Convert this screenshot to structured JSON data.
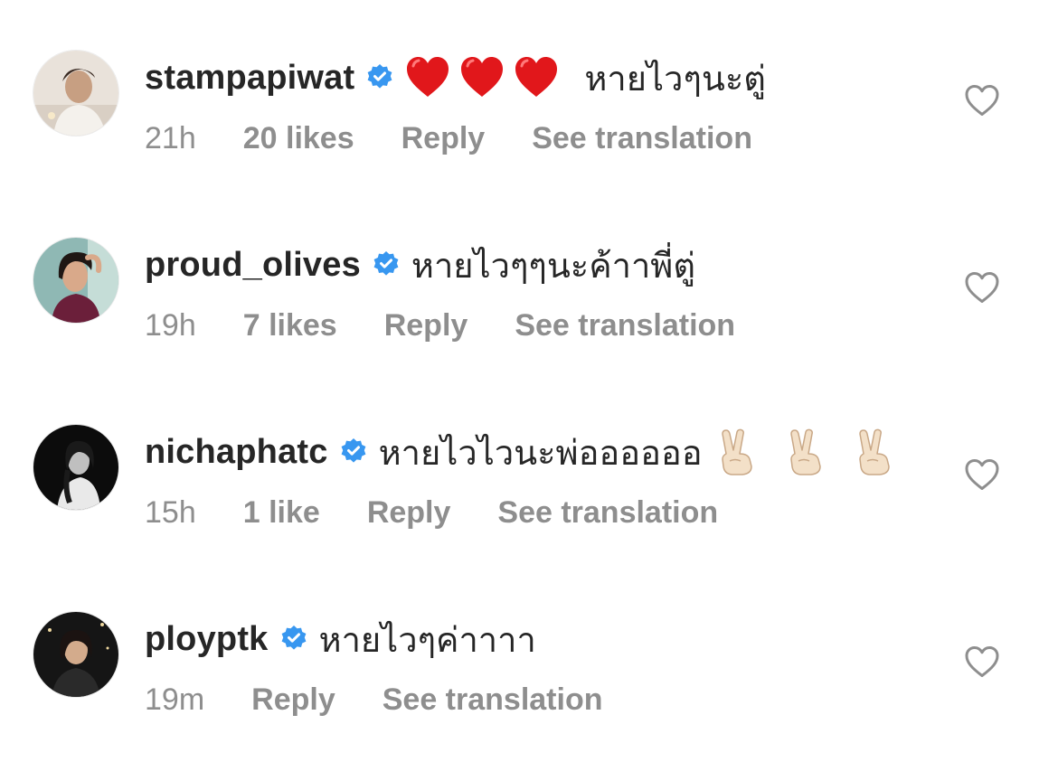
{
  "comments": [
    {
      "username": "stampapiwat",
      "verified": true,
      "text": "หายไวๆนะตู่",
      "leading_emojis": [
        "red-heart",
        "red-heart",
        "red-heart"
      ],
      "trailing_emojis": [],
      "time": "21h",
      "likes": "20 likes",
      "reply": "Reply",
      "translate": "See translation"
    },
    {
      "username": "proud_olives",
      "verified": true,
      "text": "หายไวๆๆนะค้าาพี่ตู่",
      "leading_emojis": [],
      "trailing_emojis": [],
      "time": "19h",
      "likes": "7 likes",
      "reply": "Reply",
      "translate": "See translation"
    },
    {
      "username": "nichaphatc",
      "verified": true,
      "text": "หายไวไวนะพ่ออออออ",
      "leading_emojis": [],
      "trailing_emojis": [
        "victory-hand",
        "victory-hand",
        "victory-hand"
      ],
      "time": "15h",
      "likes": "1 like",
      "reply": "Reply",
      "translate": "See translation"
    },
    {
      "username": "ploypt​k",
      "verified": true,
      "text": "หายไวๆค่าาาา",
      "leading_emojis": [],
      "trailing_emojis": [],
      "time": "19m",
      "likes": "",
      "reply": "Reply",
      "translate": "See translation"
    }
  ],
  "colors": {
    "text_primary": "#262626",
    "text_secondary": "#8e8e8e",
    "verified_blue": "#3897f0",
    "heart_red": "#e0245e"
  }
}
